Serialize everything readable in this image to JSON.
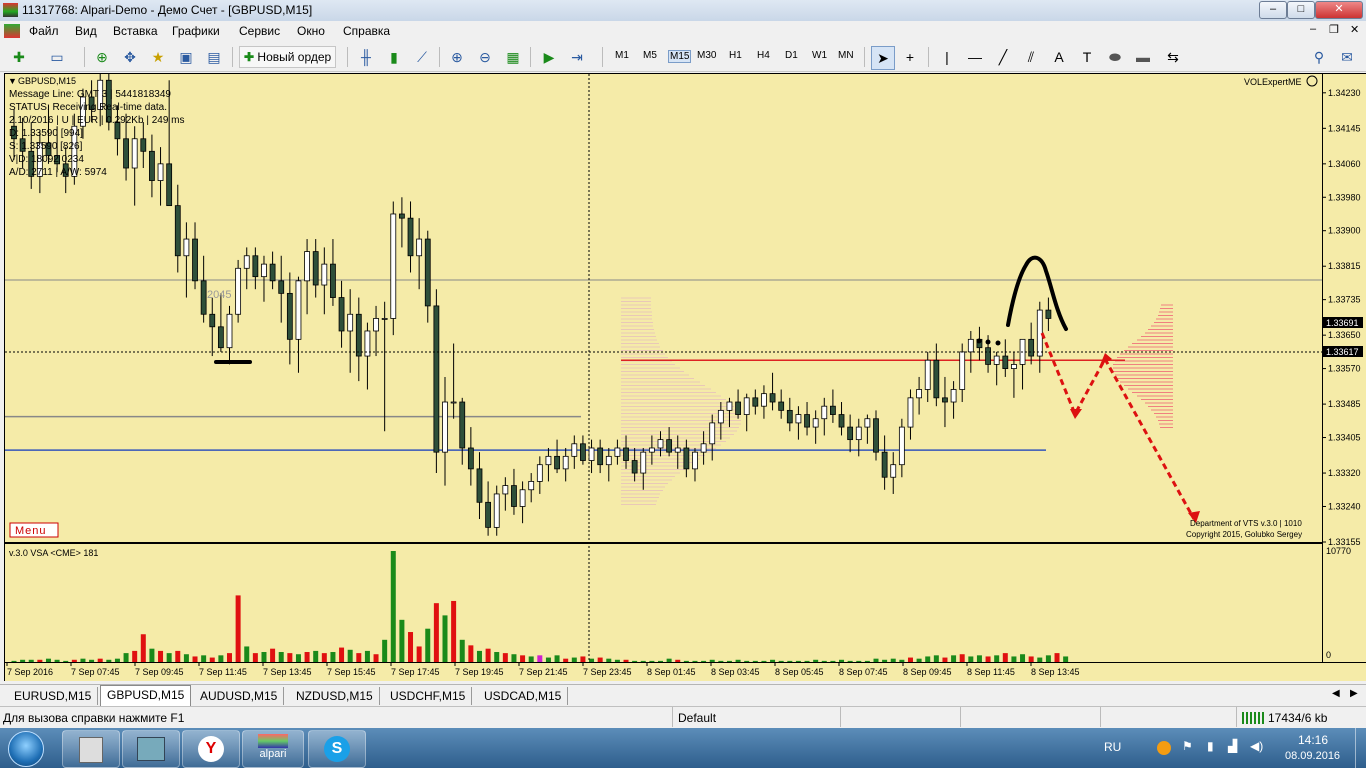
{
  "window": {
    "title": "11317768: Alpari-Demo - Демо Счет - [GBPUSD,M15]"
  },
  "menu": [
    "Файл",
    "Вид",
    "Вставка",
    "Графики",
    "Сервис",
    "Окно",
    "Справка"
  ],
  "toolbar": {
    "new_order": "Новый ордер",
    "timeframes": [
      "M1",
      "M5",
      "M15",
      "M30",
      "H1",
      "H4",
      "D1",
      "W1",
      "MN"
    ],
    "active_timeframe": "M15"
  },
  "chart": {
    "symbol_label": "GBPUSD,M15",
    "info_lines": [
      "Message Line: GMT 3 | 5441818349",
      "STATUS:  Receiving Real-time data.",
      "2.10/2016 | U | EUR | 0.292Kb | 249 ms",
      "D: 1.33590  [994]",
      "S: 1.33590  [826]",
      "V|D: 18092 0234",
      "A/D: 2711 | A/W: 5974"
    ],
    "expert_label": "VOLExpertME",
    "menu_button": "Menu",
    "level_label": "2045",
    "credits": [
      "Department of VTS  v.3.0 | 1010",
      "Copyright 2015, Golubko Sergey"
    ],
    "price_axis": [
      "1.34230",
      "1.34145",
      "1.34060",
      "1.33980",
      "1.33900",
      "1.33815",
      "1.33735",
      "1.33650",
      "1.33570",
      "1.33485",
      "1.33405",
      "1.33320",
      "1.33240",
      "1.33155"
    ],
    "current_price": "1.33691",
    "crosshair_price": "1.33617",
    "indicator_label": "v.3.0 VSA <CME> 181",
    "volume_axis_max": "10770",
    "volume_axis_min": "0",
    "time_axis": [
      "7 Sep 2016",
      "7 Sep 07:45",
      "7 Sep 09:45",
      "7 Sep 11:45",
      "7 Sep 13:45",
      "7 Sep 15:45",
      "7 Sep 17:45",
      "7 Sep 19:45",
      "7 Sep 21:45",
      "7 Sep 23:45",
      "8 Sep 01:45",
      "8 Sep 03:45",
      "8 Sep 05:45",
      "8 Sep 07:45",
      "8 Sep 09:45",
      "8 Sep 11:45",
      "8 Sep 13:45"
    ],
    "colors": {
      "background": "#f5eba8",
      "bull": "#ffffff",
      "bear": "#2e4f3a",
      "line_blue": "#3355bb",
      "line_red": "#dd2222",
      "line_gray": "#888888",
      "vol_green": "#1a8a1a",
      "vol_red": "#e01010"
    }
  },
  "chart_data": {
    "type": "candlestick",
    "y_range": [
      1.33155,
      1.34275
    ],
    "candles": [
      [
        1.3415,
        1.3419,
        1.3407,
        1.3412
      ],
      [
        1.3412,
        1.3417,
        1.3405,
        1.3409
      ],
      [
        1.3409,
        1.3416,
        1.34,
        1.3403
      ],
      [
        1.3403,
        1.3414,
        1.3399,
        1.3411
      ],
      [
        1.3411,
        1.342,
        1.3406,
        1.3408
      ],
      [
        1.3408,
        1.3415,
        1.3404,
        1.3406
      ],
      [
        1.3406,
        1.341,
        1.3399,
        1.3403
      ],
      [
        1.3403,
        1.3418,
        1.3401,
        1.3415
      ],
      [
        1.3415,
        1.3424,
        1.3412,
        1.3422
      ],
      [
        1.3422,
        1.3426,
        1.3416,
        1.3419
      ],
      [
        1.3419,
        1.343,
        1.3415,
        1.3426
      ],
      [
        1.3426,
        1.3428,
        1.3414,
        1.3416
      ],
      [
        1.3416,
        1.342,
        1.3408,
        1.3412
      ],
      [
        1.3412,
        1.3418,
        1.3402,
        1.3405
      ],
      [
        1.3405,
        1.3415,
        1.3396,
        1.3412
      ],
      [
        1.3412,
        1.3416,
        1.3405,
        1.3409
      ],
      [
        1.3409,
        1.3413,
        1.3398,
        1.3402
      ],
      [
        1.3402,
        1.341,
        1.3396,
        1.3406
      ],
      [
        1.3406,
        1.3426,
        1.3401,
        1.3396
      ],
      [
        1.3396,
        1.3401,
        1.338,
        1.3384
      ],
      [
        1.3384,
        1.3392,
        1.3374,
        1.3388
      ],
      [
        1.3388,
        1.3392,
        1.3376,
        1.3378
      ],
      [
        1.3378,
        1.3384,
        1.3368,
        1.337
      ],
      [
        1.337,
        1.3374,
        1.336,
        1.3367
      ],
      [
        1.3367,
        1.3375,
        1.3361,
        1.3362
      ],
      [
        1.3362,
        1.3372,
        1.3358,
        1.337
      ],
      [
        1.337,
        1.3383,
        1.3368,
        1.3381
      ],
      [
        1.3381,
        1.3386,
        1.3376,
        1.3384
      ],
      [
        1.3384,
        1.3386,
        1.3376,
        1.3379
      ],
      [
        1.3379,
        1.3384,
        1.3373,
        1.3382
      ],
      [
        1.3382,
        1.3385,
        1.3376,
        1.3378
      ],
      [
        1.3378,
        1.3384,
        1.3368,
        1.3375
      ],
      [
        1.3375,
        1.338,
        1.3358,
        1.3364
      ],
      [
        1.3364,
        1.3379,
        1.3356,
        1.3378
      ],
      [
        1.3378,
        1.3388,
        1.337,
        1.3385
      ],
      [
        1.3385,
        1.3388,
        1.3374,
        1.3377
      ],
      [
        1.3377,
        1.3386,
        1.337,
        1.3382
      ],
      [
        1.3382,
        1.3388,
        1.3372,
        1.3374
      ],
      [
        1.3374,
        1.3378,
        1.3362,
        1.3366
      ],
      [
        1.3366,
        1.3376,
        1.3356,
        1.337
      ],
      [
        1.337,
        1.3374,
        1.3354,
        1.336
      ],
      [
        1.336,
        1.3368,
        1.3352,
        1.3366
      ],
      [
        1.3366,
        1.3372,
        1.336,
        1.3369
      ],
      [
        1.3369,
        1.3373,
        1.3342,
        1.3369
      ],
      [
        1.3369,
        1.3397,
        1.3365,
        1.3394
      ],
      [
        1.3394,
        1.3398,
        1.3386,
        1.3393
      ],
      [
        1.3393,
        1.3397,
        1.338,
        1.3384
      ],
      [
        1.3384,
        1.3393,
        1.3376,
        1.3388
      ],
      [
        1.3388,
        1.339,
        1.3368,
        1.3372
      ],
      [
        1.3372,
        1.3376,
        1.3332,
        1.3337
      ],
      [
        1.3337,
        1.3355,
        1.3329,
        1.3349
      ],
      [
        1.3349,
        1.3363,
        1.3345,
        1.3349
      ],
      [
        1.3349,
        1.335,
        1.3334,
        1.3338
      ],
      [
        1.3338,
        1.3343,
        1.3329,
        1.3333
      ],
      [
        1.3333,
        1.3337,
        1.3321,
        1.3325
      ],
      [
        1.3325,
        1.333,
        1.3317,
        1.3319
      ],
      [
        1.3319,
        1.3329,
        1.3317,
        1.3327
      ],
      [
        1.3327,
        1.3331,
        1.3323,
        1.3329
      ],
      [
        1.3329,
        1.3333,
        1.3322,
        1.3324
      ],
      [
        1.3324,
        1.333,
        1.332,
        1.3328
      ],
      [
        1.3328,
        1.3332,
        1.3325,
        1.333
      ],
      [
        1.333,
        1.3336,
        1.3327,
        1.3334
      ],
      [
        1.3334,
        1.3338,
        1.333,
        1.3336
      ],
      [
        1.3336,
        1.334,
        1.3332,
        1.3333
      ],
      [
        1.3333,
        1.3338,
        1.333,
        1.3336
      ],
      [
        1.3336,
        1.3341,
        1.3333,
        1.3339
      ],
      [
        1.3339,
        1.3341,
        1.3334,
        1.3335
      ],
      [
        1.3335,
        1.334,
        1.3332,
        1.3338
      ],
      [
        1.3338,
        1.334,
        1.3332,
        1.3334
      ],
      [
        1.3334,
        1.3338,
        1.333,
        1.3336
      ],
      [
        1.3336,
        1.334,
        1.3334,
        1.3338
      ],
      [
        1.3338,
        1.3341,
        1.3333,
        1.3335
      ],
      [
        1.3335,
        1.3338,
        1.333,
        1.3332
      ],
      [
        1.3332,
        1.3338,
        1.3328,
        1.3337
      ],
      [
        1.3337,
        1.3341,
        1.3334,
        1.3338
      ],
      [
        1.3338,
        1.3342,
        1.3336,
        1.334
      ],
      [
        1.334,
        1.3343,
        1.3336,
        1.3337
      ],
      [
        1.3337,
        1.3341,
        1.3333,
        1.3338
      ],
      [
        1.3338,
        1.334,
        1.3331,
        1.3333
      ],
      [
        1.3333,
        1.3338,
        1.333,
        1.3337
      ],
      [
        1.3337,
        1.3342,
        1.3334,
        1.3339
      ],
      [
        1.3339,
        1.3346,
        1.3335,
        1.3344
      ],
      [
        1.3344,
        1.3349,
        1.334,
        1.3347
      ],
      [
        1.3347,
        1.335,
        1.3343,
        1.3349
      ],
      [
        1.3349,
        1.3352,
        1.3345,
        1.3346
      ],
      [
        1.3346,
        1.3351,
        1.3342,
        1.335
      ],
      [
        1.335,
        1.3352,
        1.3346,
        1.3348
      ],
      [
        1.3348,
        1.3353,
        1.3345,
        1.3351
      ],
      [
        1.3351,
        1.3356,
        1.3347,
        1.3349
      ],
      [
        1.3349,
        1.3352,
        1.3345,
        1.3347
      ],
      [
        1.3347,
        1.335,
        1.3342,
        1.3344
      ],
      [
        1.3344,
        1.3348,
        1.334,
        1.3346
      ],
      [
        1.3346,
        1.3349,
        1.3341,
        1.3343
      ],
      [
        1.3343,
        1.3347,
        1.3339,
        1.3345
      ],
      [
        1.3345,
        1.335,
        1.3341,
        1.3348
      ],
      [
        1.3348,
        1.3352,
        1.3344,
        1.3346
      ],
      [
        1.3346,
        1.3349,
        1.3341,
        1.3343
      ],
      [
        1.3343,
        1.3346,
        1.3337,
        1.334
      ],
      [
        1.334,
        1.3345,
        1.3336,
        1.3343
      ],
      [
        1.3343,
        1.3346,
        1.3339,
        1.3345
      ],
      [
        1.3345,
        1.3347,
        1.3335,
        1.3337
      ],
      [
        1.3337,
        1.3341,
        1.3328,
        1.3331
      ],
      [
        1.3331,
        1.3337,
        1.3327,
        1.3334
      ],
      [
        1.3334,
        1.3345,
        1.3331,
        1.3343
      ],
      [
        1.3343,
        1.3352,
        1.334,
        1.335
      ],
      [
        1.335,
        1.3355,
        1.3346,
        1.3352
      ],
      [
        1.3352,
        1.3361,
        1.3349,
        1.3359
      ],
      [
        1.3359,
        1.3363,
        1.3348,
        1.335
      ],
      [
        1.335,
        1.3355,
        1.3343,
        1.3349
      ],
      [
        1.3349,
        1.3354,
        1.3345,
        1.3352
      ],
      [
        1.3352,
        1.3363,
        1.3349,
        1.3361
      ],
      [
        1.3361,
        1.3366,
        1.3356,
        1.3364
      ],
      [
        1.3364,
        1.3367,
        1.3359,
        1.3362
      ],
      [
        1.3362,
        1.3365,
        1.3356,
        1.3358
      ],
      [
        1.3358,
        1.3361,
        1.3353,
        1.336
      ],
      [
        1.336,
        1.3364,
        1.3355,
        1.3357
      ],
      [
        1.3357,
        1.3361,
        1.335,
        1.3358
      ],
      [
        1.3358,
        1.3362,
        1.3352,
        1.3364
      ],
      [
        1.3364,
        1.3368,
        1.3358,
        1.336
      ],
      [
        1.336,
        1.3373,
        1.3356,
        1.3371
      ],
      [
        1.3371,
        1.3374,
        1.3366,
        1.3369
      ]
    ],
    "volume": [
      [
        1,
        "g"
      ],
      [
        2,
        "g"
      ],
      [
        2,
        "g"
      ],
      [
        2,
        "r"
      ],
      [
        3,
        "g"
      ],
      [
        2,
        "g"
      ],
      [
        1,
        "g"
      ],
      [
        2,
        "r"
      ],
      [
        3,
        "g"
      ],
      [
        2,
        "g"
      ],
      [
        3,
        "r"
      ],
      [
        2,
        "g"
      ],
      [
        3,
        "g"
      ],
      [
        8,
        "g"
      ],
      [
        10,
        "r"
      ],
      [
        25,
        "r"
      ],
      [
        12,
        "g"
      ],
      [
        10,
        "r"
      ],
      [
        8,
        "g"
      ],
      [
        10,
        "r"
      ],
      [
        7,
        "g"
      ],
      [
        5,
        "r"
      ],
      [
        6,
        "g"
      ],
      [
        4,
        "r"
      ],
      [
        6,
        "g"
      ],
      [
        8,
        "r"
      ],
      [
        60,
        "r"
      ],
      [
        14,
        "g"
      ],
      [
        8,
        "r"
      ],
      [
        9,
        "g"
      ],
      [
        12,
        "r"
      ],
      [
        9,
        "g"
      ],
      [
        8,
        "r"
      ],
      [
        7,
        "g"
      ],
      [
        9,
        "r"
      ],
      [
        10,
        "g"
      ],
      [
        8,
        "r"
      ],
      [
        9,
        "g"
      ],
      [
        13,
        "r"
      ],
      [
        11,
        "g"
      ],
      [
        8,
        "r"
      ],
      [
        10,
        "g"
      ],
      [
        7,
        "r"
      ],
      [
        20,
        "g"
      ],
      [
        100,
        "g"
      ],
      [
        38,
        "g"
      ],
      [
        27,
        "r"
      ],
      [
        14,
        "r"
      ],
      [
        30,
        "g"
      ],
      [
        53,
        "r"
      ],
      [
        42,
        "g"
      ],
      [
        55,
        "r"
      ],
      [
        20,
        "g"
      ],
      [
        15,
        "r"
      ],
      [
        10,
        "g"
      ],
      [
        12,
        "r"
      ],
      [
        9,
        "g"
      ],
      [
        8,
        "r"
      ],
      [
        7,
        "g"
      ],
      [
        6,
        "r"
      ],
      [
        5,
        "g"
      ],
      [
        6,
        "m"
      ],
      [
        4,
        "g"
      ],
      [
        6,
        "g"
      ],
      [
        3,
        "r"
      ],
      [
        4,
        "g"
      ],
      [
        5,
        "r"
      ],
      [
        3,
        "g"
      ],
      [
        4,
        "r"
      ],
      [
        3,
        "g"
      ],
      [
        2,
        "g"
      ],
      [
        2,
        "r"
      ],
      [
        1,
        "g"
      ],
      [
        1,
        "g"
      ],
      [
        1,
        "g"
      ],
      [
        1,
        "g"
      ],
      [
        3,
        "g"
      ],
      [
        2,
        "r"
      ],
      [
        1,
        "g"
      ],
      [
        1,
        "g"
      ],
      [
        1,
        "g"
      ],
      [
        2,
        "g"
      ],
      [
        1,
        "g"
      ],
      [
        1,
        "g"
      ],
      [
        2,
        "g"
      ],
      [
        1,
        "g"
      ],
      [
        1,
        "g"
      ],
      [
        1,
        "g"
      ],
      [
        2,
        "g"
      ],
      [
        1,
        "g"
      ],
      [
        1,
        "g"
      ],
      [
        1,
        "g"
      ],
      [
        1,
        "g"
      ],
      [
        2,
        "g"
      ],
      [
        1,
        "g"
      ],
      [
        1,
        "g"
      ],
      [
        2,
        "g"
      ],
      [
        1,
        "g"
      ],
      [
        1,
        "g"
      ],
      [
        1,
        "g"
      ],
      [
        3,
        "g"
      ],
      [
        2,
        "g"
      ],
      [
        3,
        "g"
      ],
      [
        2,
        "g"
      ],
      [
        4,
        "r"
      ],
      [
        3,
        "g"
      ],
      [
        5,
        "g"
      ],
      [
        6,
        "g"
      ],
      [
        4,
        "r"
      ],
      [
        6,
        "g"
      ],
      [
        7,
        "r"
      ],
      [
        5,
        "g"
      ],
      [
        6,
        "g"
      ],
      [
        5,
        "r"
      ],
      [
        6,
        "g"
      ],
      [
        8,
        "r"
      ],
      [
        5,
        "g"
      ],
      [
        7,
        "g"
      ],
      [
        5,
        "r"
      ],
      [
        4,
        "g"
      ],
      [
        6,
        "g"
      ],
      [
        8,
        "r"
      ],
      [
        5,
        "g"
      ]
    ],
    "levels": [
      {
        "price": 1.33455,
        "color": "#888888"
      },
      {
        "price": 1.33782,
        "color": "#888888"
      },
      {
        "price": 1.33375,
        "color": "#3355bb"
      },
      {
        "price": 1.3359,
        "color": "#dd2222"
      }
    ]
  },
  "tabs": [
    "EURUSD,M15",
    "GBPUSD,M15",
    "AUDUSD,M15",
    "NZDUSD,M15",
    "USDCHF,M15",
    "USDCAD,M15"
  ],
  "active_tab": "GBPUSD,M15",
  "status": {
    "help": "Для вызова справки нажмите F1",
    "profile": "Default",
    "traffic": "17434/6 kb"
  },
  "taskbar": {
    "lang": "RU",
    "time": "14:16",
    "date": "08.09.2016",
    "alpari_label": "alpari"
  }
}
